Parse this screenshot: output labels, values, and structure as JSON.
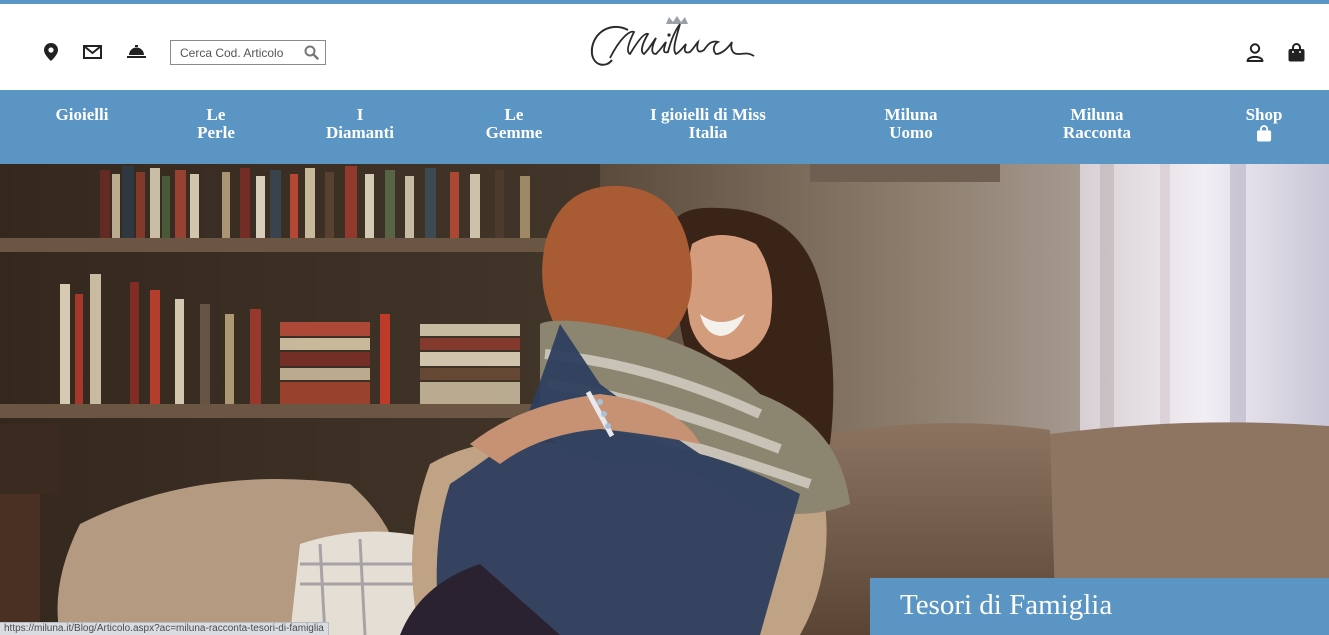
{
  "header": {
    "icons": [
      "map-pin-icon",
      "envelope-icon",
      "service-bell-icon",
      "user-icon",
      "shopping-bag-icon"
    ],
    "search": {
      "placeholder": "Cerca Cod. Articolo",
      "value": ""
    },
    "logo_text": "Miluna"
  },
  "nav": {
    "items": [
      {
        "lines": [
          "Gioielli"
        ]
      },
      {
        "lines": [
          "Le",
          "Perle"
        ]
      },
      {
        "lines": [
          "I",
          "Diamanti"
        ]
      },
      {
        "lines": [
          "Le",
          "Gemme"
        ]
      },
      {
        "lines": [
          "I gioielli di Miss",
          "Italia"
        ]
      },
      {
        "lines": [
          "Miluna",
          "Uomo"
        ]
      },
      {
        "lines": [
          "Miluna",
          "Racconta"
        ]
      },
      {
        "lines": [
          "Shop"
        ]
      }
    ]
  },
  "hero": {
    "caption": "Tesori di Famiglia"
  },
  "status_bar": {
    "url": "https://miluna.it/Blog/Articolo.aspx?ac=miluna-racconta-tesori-di-famiglia"
  },
  "colors": {
    "accent": "#5b95c4",
    "text_dark": "#222222"
  }
}
